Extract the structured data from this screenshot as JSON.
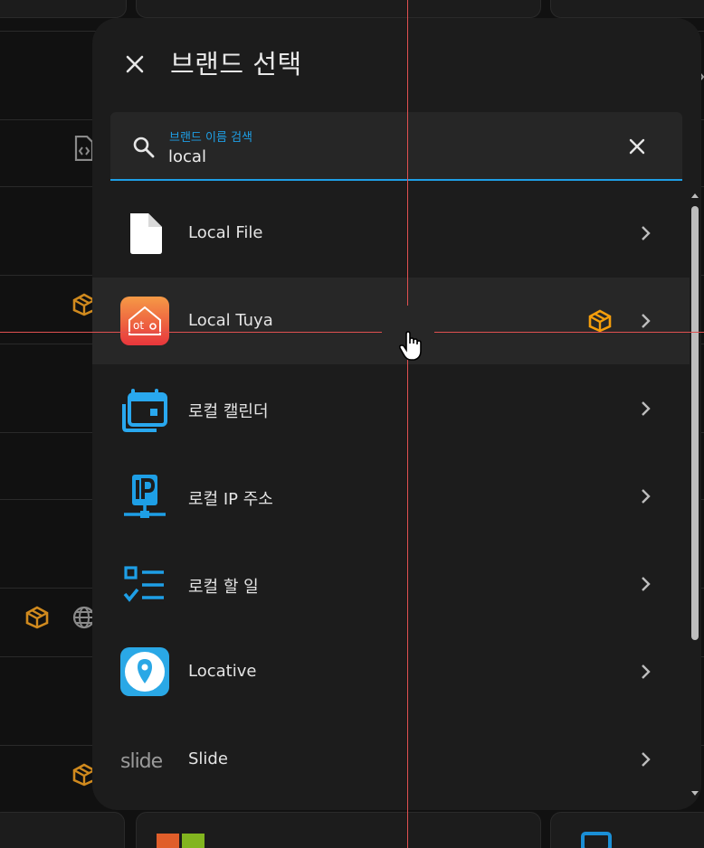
{
  "dialog": {
    "title": "브랜드 선택",
    "search": {
      "label": "브랜드 이름 검색",
      "value": "local"
    }
  },
  "items": [
    {
      "label": "Local File",
      "icon": "file-icon",
      "badge": false
    },
    {
      "label": "Local Tuya",
      "icon": "tuya-icon",
      "badge": true
    },
    {
      "label": "로컬 캘린더",
      "icon": "calendar-icon",
      "badge": false
    },
    {
      "label": "로컬 IP 주소",
      "icon": "ip-icon",
      "badge": false
    },
    {
      "label": "로컬 할 일",
      "icon": "todo-icon",
      "badge": false
    },
    {
      "label": "Locative",
      "icon": "locative-icon",
      "badge": false
    },
    {
      "label": "Slide",
      "icon": "slide-logo",
      "badge": false
    }
  ],
  "colors": {
    "accent": "#1e9fe6",
    "badge": "#f59e0b",
    "background": "#111111",
    "surface": "#1c1c1c"
  }
}
